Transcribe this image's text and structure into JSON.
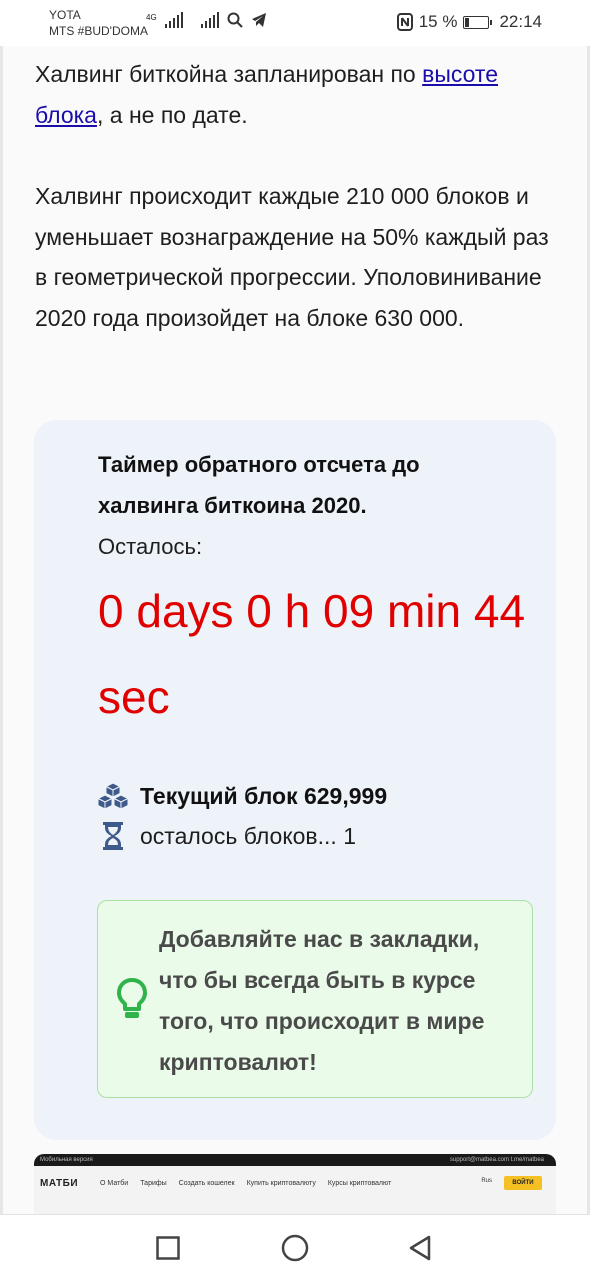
{
  "status_bar": {
    "carrier1": "YOTA",
    "carrier2": "MTS #BUD'DOMA",
    "network_badge": "4G",
    "battery_percent": "15 %",
    "time": "22:14",
    "icons": [
      "signal-icon",
      "search-icon",
      "telegram-icon",
      "nfc-icon",
      "battery-icon"
    ]
  },
  "article": {
    "para1_before": "Халвинг биткойна запланирован по ",
    "para1_link": "высоте блока",
    "para1_after": ", а не по дате.",
    "para2": "Халвинг происходит каждые 210 000 блоков и уменьшает вознаграждение на 50% каждый раз в геометрической прогрессии. Уполовинивание 2020 года произойдет на блоке 630 000."
  },
  "timer_card": {
    "title": "Таймер обратного отсчета до халвинга биткоина 2020.",
    "remaining_label": "Осталось:",
    "countdown": "0 days 0 h 09 min 44 sec",
    "current_block_label": "Текущий блок 629,999",
    "blocks_left_label": "осталось блоков... 1",
    "tip": "Добавляйте нас в закладки, что бы всегда быть в курсе того, что происходит в мире криптовалют!",
    "countdown_color": "#e00000"
  },
  "preview": {
    "topbar_left": "Мобильная версия",
    "topbar_right": "support@matbea.com   t.me/matbea",
    "logo": "МАТБИ",
    "nav_items": [
      "О Матби",
      "Тарифы",
      "Создать кошелек",
      "Купить криптовалюту",
      "Курсы криптовалют"
    ],
    "lang": "Rus",
    "login": "ВОЙТИ"
  },
  "navbar": {
    "buttons": [
      "recent-apps-button",
      "home-button",
      "back-button"
    ]
  }
}
